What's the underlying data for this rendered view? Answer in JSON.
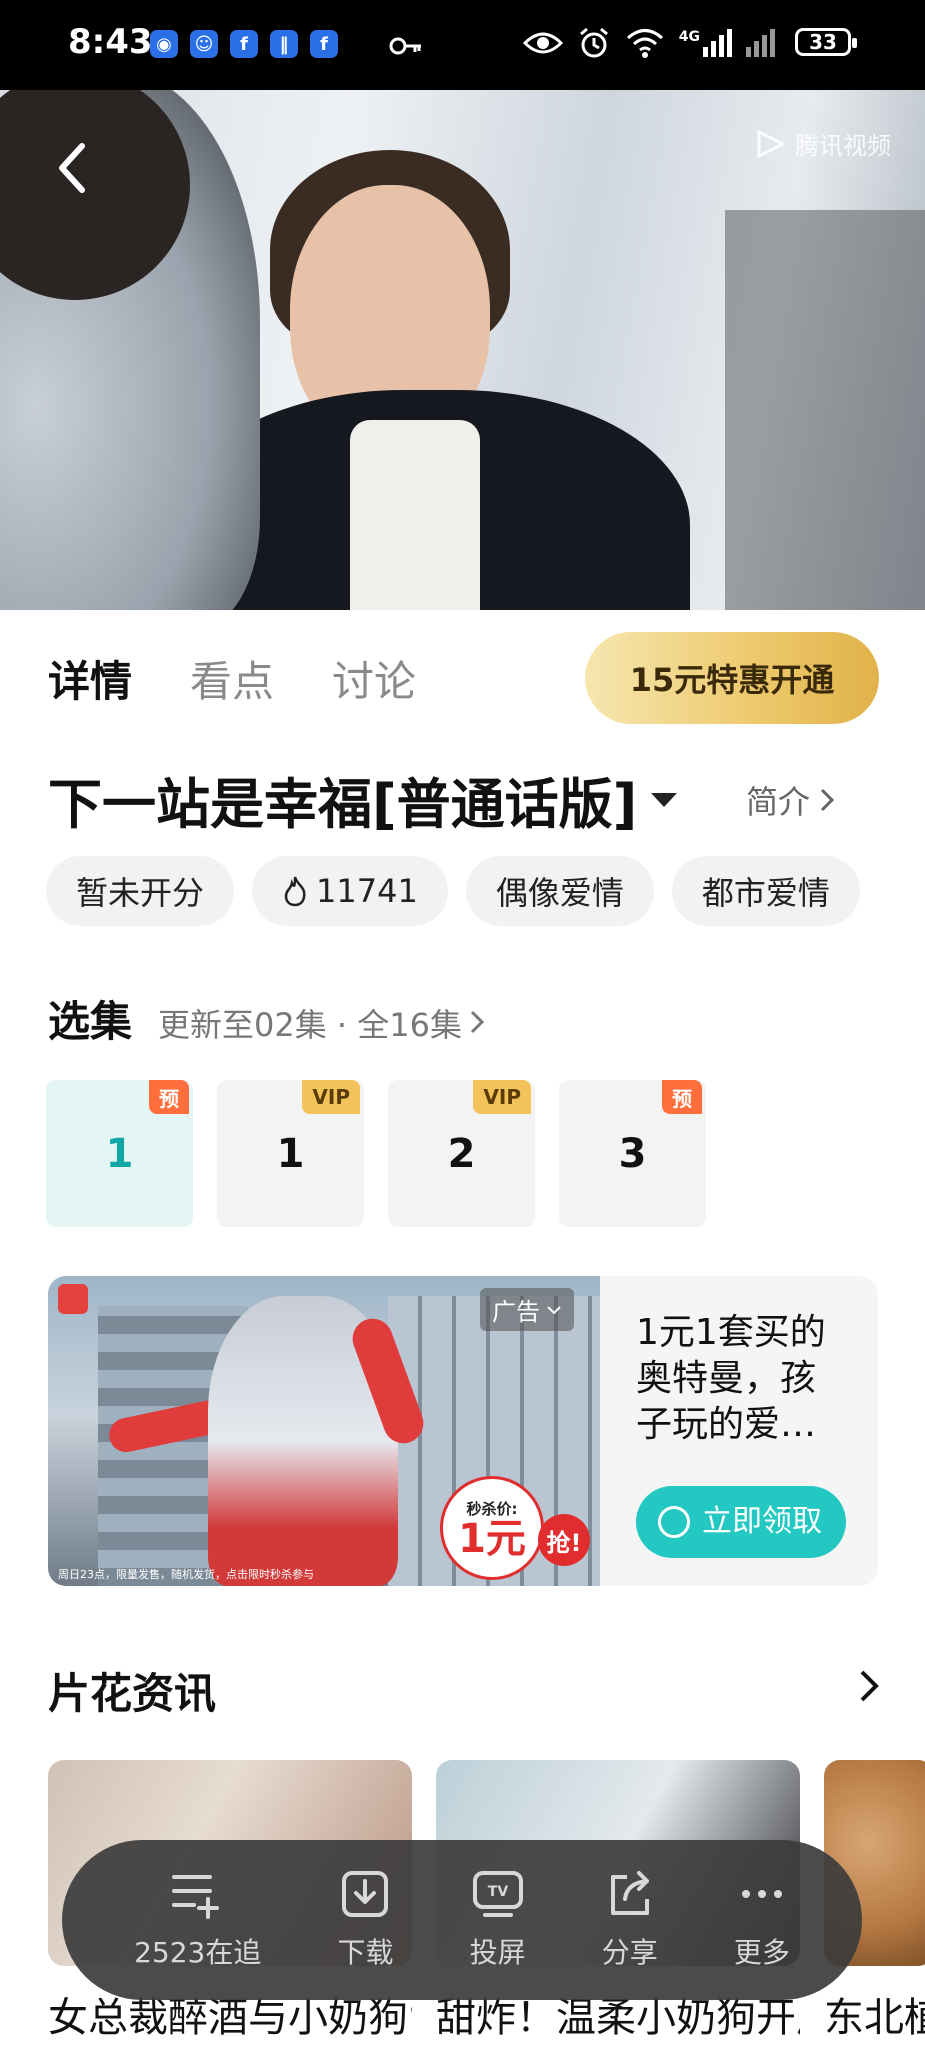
{
  "status_bar": {
    "time": "8:43",
    "battery": "33",
    "network": "4G",
    "app_icons": [
      "qq-browser-icon",
      "qq-icon",
      "facebook-icon",
      "app-icon",
      "facebook-icon"
    ]
  },
  "video": {
    "watermark": "腾讯视频"
  },
  "tabs": [
    {
      "label": "详情",
      "active": true
    },
    {
      "label": "看点",
      "active": false
    },
    {
      "label": "讨论",
      "active": false
    }
  ],
  "vip_button": "15元特惠开通",
  "show": {
    "title": "下一站是幸福[普通话版]",
    "intro_label": "简介",
    "chips": [
      "暂未开分",
      "11741",
      "偶像爱情",
      "都市爱情"
    ]
  },
  "episodes": {
    "title": "选集",
    "meta": "更新至02集 · 全16集",
    "items": [
      {
        "label": "1",
        "badge": "预",
        "badge_type": "pre",
        "selected": true
      },
      {
        "label": "1",
        "badge": "VIP",
        "badge_type": "vip",
        "selected": false
      },
      {
        "label": "2",
        "badge": "VIP",
        "badge_type": "vip",
        "selected": false
      },
      {
        "label": "3",
        "badge": "预",
        "badge_type": "pre",
        "selected": false
      }
    ]
  },
  "ad": {
    "badge": "广告",
    "price_label": "秒杀价:",
    "price_value": "1元",
    "grab": "抢!",
    "caption": "周日23点，限量发售，随机发货，点击限时秒杀参与",
    "text": "1元1套买的奥特曼，孩子玩的爱…",
    "cta": "立即领取"
  },
  "news": {
    "title": "片花资讯",
    "cards": [
      {
        "title": "女总裁醉酒与小奶狗“激情”一夜"
      },
      {
        "title": "甜炸！温柔小奶狗开启深情模式"
      },
      {
        "title": "东北植"
      }
    ]
  },
  "action_bar": [
    {
      "icon": "add-to-list-icon",
      "label": "2523在追"
    },
    {
      "icon": "download-icon",
      "label": "下载"
    },
    {
      "icon": "tv-cast-icon",
      "label": "投屏"
    },
    {
      "icon": "share-icon",
      "label": "分享"
    },
    {
      "icon": "more-icon",
      "label": "更多"
    }
  ],
  "colors": {
    "accent_teal": "#11a7a5",
    "cta_teal": "#22c8c1",
    "vip_gold": "#edc86a",
    "pre_badge": "#ff6f3e"
  }
}
